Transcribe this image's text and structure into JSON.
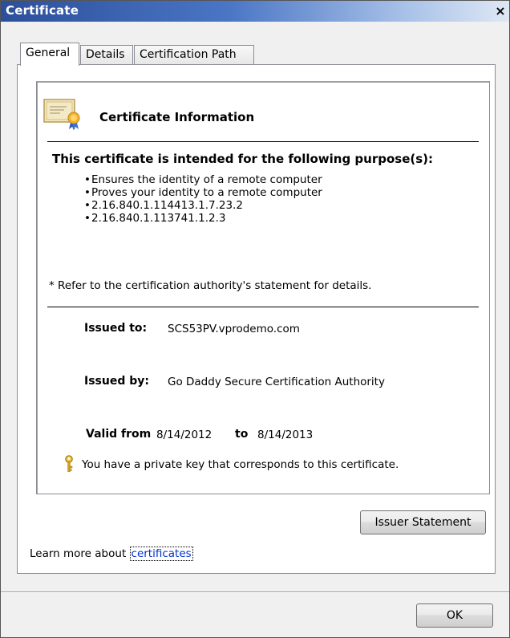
{
  "window": {
    "title": "Certificate",
    "close_glyph": "×"
  },
  "tabs": [
    {
      "label": "General",
      "active": true
    },
    {
      "label": "Details",
      "active": false
    },
    {
      "label": "Certification Path",
      "active": false
    }
  ],
  "info": {
    "icon": "certificate-icon",
    "title": "Certificate Information",
    "purpose_heading": "This certificate is intended for the following purpose(s):",
    "purposes": [
      "Ensures the identity of a remote computer",
      "Proves your identity to a remote computer",
      "2.16.840.1.114413.1.7.23.2",
      "2.16.840.1.113741.1.2.3"
    ],
    "footnote": "* Refer to the certification authority's statement for details."
  },
  "details": {
    "issued_to_label": "Issued to:",
    "issued_to": "SCS53PV.vprodemo.com",
    "issued_by_label": "Issued by:",
    "issued_by": "Go Daddy Secure Certification Authority",
    "valid_from_label": "Valid from",
    "valid_from": "8/14/2012",
    "valid_to_label": "to",
    "valid_to": "8/14/2013",
    "private_key_icon": "key-icon",
    "private_key_text": "You have a private key that corresponds to this certificate."
  },
  "buttons": {
    "issuer_statement": "Issuer Statement",
    "ok": "OK"
  },
  "learn_more": {
    "prefix": "Learn more about ",
    "link": "certificates"
  },
  "colors": {
    "link": "#0033cc",
    "titlebar_start": "#2c4f9a",
    "dialog_bg": "#f0f0f0"
  }
}
